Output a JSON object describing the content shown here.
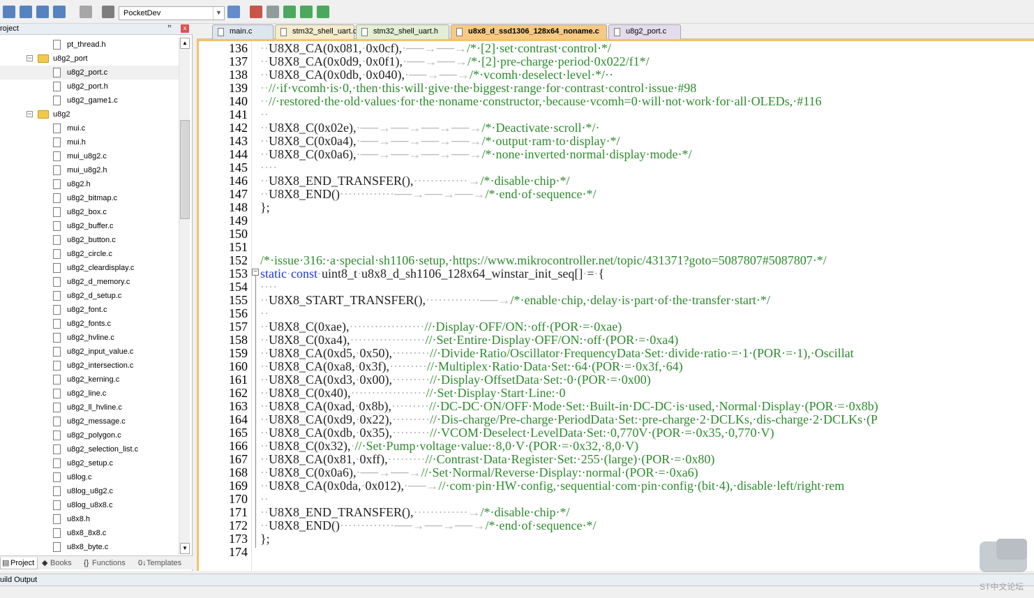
{
  "toolbar": {
    "target": "PocketDev",
    "buttons": [
      "rebuild-icon",
      "build-icon",
      "batch-build-icon",
      "translate-icon",
      "stop-build-icon",
      "download-icon",
      "target-options-icon",
      "manage-project-icon",
      "select-packs-icon",
      "manage-rte-icon",
      "diamond-icon",
      "pack-installer-icon"
    ]
  },
  "project_panel": {
    "title": "roject",
    "pin": "ꟸ",
    "close": "x",
    "tree": [
      {
        "label": "pt_thread.h",
        "type": "file",
        "level": 2
      },
      {
        "label": "u8g2_port",
        "type": "folder",
        "level": 1,
        "expander": "−"
      },
      {
        "label": "u8g2_port.c",
        "type": "file",
        "level": 2,
        "selected": true
      },
      {
        "label": "u8g2_port.h",
        "type": "file",
        "level": 2
      },
      {
        "label": "u8g2_game1.c",
        "type": "file",
        "level": 2
      },
      {
        "label": "u8g2",
        "type": "folder",
        "level": 1,
        "expander": "−"
      },
      {
        "label": "mui.c",
        "type": "file",
        "level": 2
      },
      {
        "label": "mui.h",
        "type": "file",
        "level": 2
      },
      {
        "label": "mui_u8g2.c",
        "type": "file",
        "level": 2
      },
      {
        "label": "mui_u8g2.h",
        "type": "file",
        "level": 2
      },
      {
        "label": "u8g2.h",
        "type": "file",
        "level": 2
      },
      {
        "label": "u8g2_bitmap.c",
        "type": "file",
        "level": 2
      },
      {
        "label": "u8g2_box.c",
        "type": "file",
        "level": 2
      },
      {
        "label": "u8g2_buffer.c",
        "type": "file",
        "level": 2
      },
      {
        "label": "u8g2_button.c",
        "type": "file",
        "level": 2
      },
      {
        "label": "u8g2_circle.c",
        "type": "file",
        "level": 2
      },
      {
        "label": "u8g2_cleardisplay.c",
        "type": "file",
        "level": 2
      },
      {
        "label": "u8g2_d_memory.c",
        "type": "file",
        "level": 2
      },
      {
        "label": "u8g2_d_setup.c",
        "type": "file",
        "level": 2
      },
      {
        "label": "u8g2_font.c",
        "type": "file",
        "level": 2
      },
      {
        "label": "u8g2_fonts.c",
        "type": "file",
        "level": 2
      },
      {
        "label": "u8g2_hvline.c",
        "type": "file",
        "level": 2
      },
      {
        "label": "u8g2_input_value.c",
        "type": "file",
        "level": 2
      },
      {
        "label": "u8g2_intersection.c",
        "type": "file",
        "level": 2
      },
      {
        "label": "u8g2_kerning.c",
        "type": "file",
        "level": 2
      },
      {
        "label": "u8g2_line.c",
        "type": "file",
        "level": 2
      },
      {
        "label": "u8g2_ll_hvline.c",
        "type": "file",
        "level": 2
      },
      {
        "label": "u8g2_message.c",
        "type": "file",
        "level": 2
      },
      {
        "label": "u8g2_polygon.c",
        "type": "file",
        "level": 2
      },
      {
        "label": "u8g2_selection_list.c",
        "type": "file",
        "level": 2
      },
      {
        "label": "u8g2_setup.c",
        "type": "file",
        "level": 2
      },
      {
        "label": "u8log.c",
        "type": "file",
        "level": 2
      },
      {
        "label": "u8log_u8g2.c",
        "type": "file",
        "level": 2
      },
      {
        "label": "u8log_u8x8.c",
        "type": "file",
        "level": 2
      },
      {
        "label": "u8x8.h",
        "type": "file",
        "level": 2
      },
      {
        "label": "u8x8_8x8.c",
        "type": "file",
        "level": 2
      },
      {
        "label": "u8x8_byte.c",
        "type": "file",
        "level": 2
      }
    ],
    "tabs": [
      {
        "label": "Project",
        "icon": "▤",
        "active": true
      },
      {
        "label": "Books",
        "icon": "◆",
        "active": false
      },
      {
        "label": "Functions",
        "icon": "{}",
        "active": false
      },
      {
        "label": "Templates",
        "icon": "0↓",
        "active": false
      }
    ]
  },
  "editor": {
    "tabs": [
      {
        "label": "main.c",
        "color": "#dde5f0",
        "active": false
      },
      {
        "label": "stm32_shell_uart.c",
        "color": "#f4eccb",
        "active": false
      },
      {
        "label": "stm32_shell_uart.h",
        "color": "#e4eed4",
        "active": false
      },
      {
        "label": "u8x8_d_ssd1306_128x64_noname.c",
        "color": "#f7ca83",
        "active": true
      },
      {
        "label": "u8g2_port.c",
        "color": "#e3dcef",
        "active": false
      }
    ],
    "lines": [
      {
        "n": "136",
        "code": "··U8X8_CA(0x081,·0x0cf),·──→──→/*·[2]·set·contrast·control·*/"
      },
      {
        "n": "137",
        "code": "··U8X8_CA(0x0d9,·0x0f1),·──→──→/*·[2]·pre-charge·period·0x022/f1*/"
      },
      {
        "n": "138",
        "code": "··U8X8_CA(0x0db,·0x040),·──→──→/*·vcomh·deselect·level·*/··"
      },
      {
        "n": "139",
        "code": "··//·if·vcomh·is·0,·then·this·will·give·the·biggest·range·for·contrast·control·issue·#98"
      },
      {
        "n": "140",
        "code": "··//·restored·the·old·values·for·the·noname·constructor,·because·vcomh=0·will·not·work·for·all·OLEDs,·#116"
      },
      {
        "n": "141",
        "code": "··"
      },
      {
        "n": "142",
        "code": "··U8X8_C(0x02e),·──→──→──→──→/*·Deactivate·scroll·*/·"
      },
      {
        "n": "143",
        "code": "··U8X8_C(0x0a4),·──→──→──→──→/*·output·ram·to·display·*/"
      },
      {
        "n": "144",
        "code": "··U8X8_C(0x0a6),·──→──→──→──→/*·none·inverted·normal·display·mode·*/"
      },
      {
        "n": "145",
        "code": "····"
      },
      {
        "n": "146",
        "code": "··U8X8_END_TRANSFER(),·············→/*·disable·chip·*/"
      },
      {
        "n": "147",
        "code": "··U8X8_END()·············──→──→──→/*·end·of·sequence·*/"
      },
      {
        "n": "148",
        "code": "};"
      },
      {
        "n": "149",
        "code": ""
      },
      {
        "n": "150",
        "code": ""
      },
      {
        "n": "151",
        "code": ""
      },
      {
        "n": "152",
        "code": "/*·issue·316:·a·special·sh1106·setup,·https://www.mikrocontroller.net/topic/431371?goto=5087807#5087807·*/"
      },
      {
        "n": "153",
        "code": "static·const·uint8_t·u8x8_d_sh1106_128x64_winstar_init_seq[]·=·{"
      },
      {
        "n": "154",
        "code": "····"
      },
      {
        "n": "155",
        "code": "··U8X8_START_TRANSFER(),·············──→/*·enable·chip,·delay·is·part·of·the·transfer·start·*/"
      },
      {
        "n": "156",
        "code": "··"
      },
      {
        "n": "157",
        "code": "··U8X8_C(0xae),··················//·Display·OFF/ON:·off·(POR·=·0xae)"
      },
      {
        "n": "158",
        "code": "··U8X8_C(0xa4),··················//·Set·Entire·Display·OFF/ON:·off·(POR·=·0xa4)"
      },
      {
        "n": "159",
        "code": "··U8X8_CA(0xd5,·0x50),·········//·Divide·Ratio/Oscillator·FrequencyData·Set:·divide·ratio·=·1·(POR·=·1),·Oscillat"
      },
      {
        "n": "160",
        "code": "··U8X8_CA(0xa8,·0x3f),·········//·Multiplex·Ratio·Data·Set:·64·(POR·=·0x3f,·64)"
      },
      {
        "n": "161",
        "code": "··U8X8_CA(0xd3,·0x00),·········//·Display·OffsetData·Set:·0·(POR·=·0x00)"
      },
      {
        "n": "162",
        "code": "··U8X8_C(0x40),··················//·Set·Display·Start·Line:·0"
      },
      {
        "n": "163",
        "code": "··U8X8_CA(0xad,·0x8b),·········//·DC-DC·ON/OFF·Mode·Set:·Built-in·DC-DC·is·used,·Normal·Display·(POR·=·0x8b)"
      },
      {
        "n": "164",
        "code": "··U8X8_CA(0xd9,·0x22),·········//·Dis-charge/Pre-charge·PeriodData·Set:·pre-charge·2·DCLKs,·dis-charge·2·DCLKs·(P"
      },
      {
        "n": "165",
        "code": "··U8X8_CA(0xdb,·0x35),·········//·VCOM·Deselect·LevelData·Set:·0,770V·(POR·=·0x35,·0,770·V)"
      },
      {
        "n": "166",
        "code": "··U8X8_C(0x32),·//·Set·Pump·voltage·value:·8,0·V·(POR·=·0x32,·8,0·V)"
      },
      {
        "n": "167",
        "code": "··U8X8_CA(0x81,·0xff),·········//·Contrast·Data·Register·Set:·255·(large)·(POR·=·0x80)"
      },
      {
        "n": "168",
        "code": "··U8X8_C(0x0a6),·──→──→//·Set·Normal/Reverse·Display:·normal·(POR·=·0xa6)"
      },
      {
        "n": "169",
        "code": "··U8X8_CA(0x0da,·0x012),·──→//·com·pin·HW·config,·sequential·com·pin·config·(bit·4),·disable·left/right·rem"
      },
      {
        "n": "170",
        "code": "··"
      },
      {
        "n": "171",
        "code": "··U8X8_END_TRANSFER(),·············→/*·disable·chip·*/"
      },
      {
        "n": "172",
        "code": "··U8X8_END()·············──→──→──→/*·end·of·sequence·*/"
      },
      {
        "n": "173",
        "code": "};"
      },
      {
        "n": "174",
        "code": ""
      }
    ],
    "fold_marker": "−"
  },
  "build_output": {
    "title": "uild Output"
  },
  "watermark": {
    "text": "ST中文论坛"
  }
}
